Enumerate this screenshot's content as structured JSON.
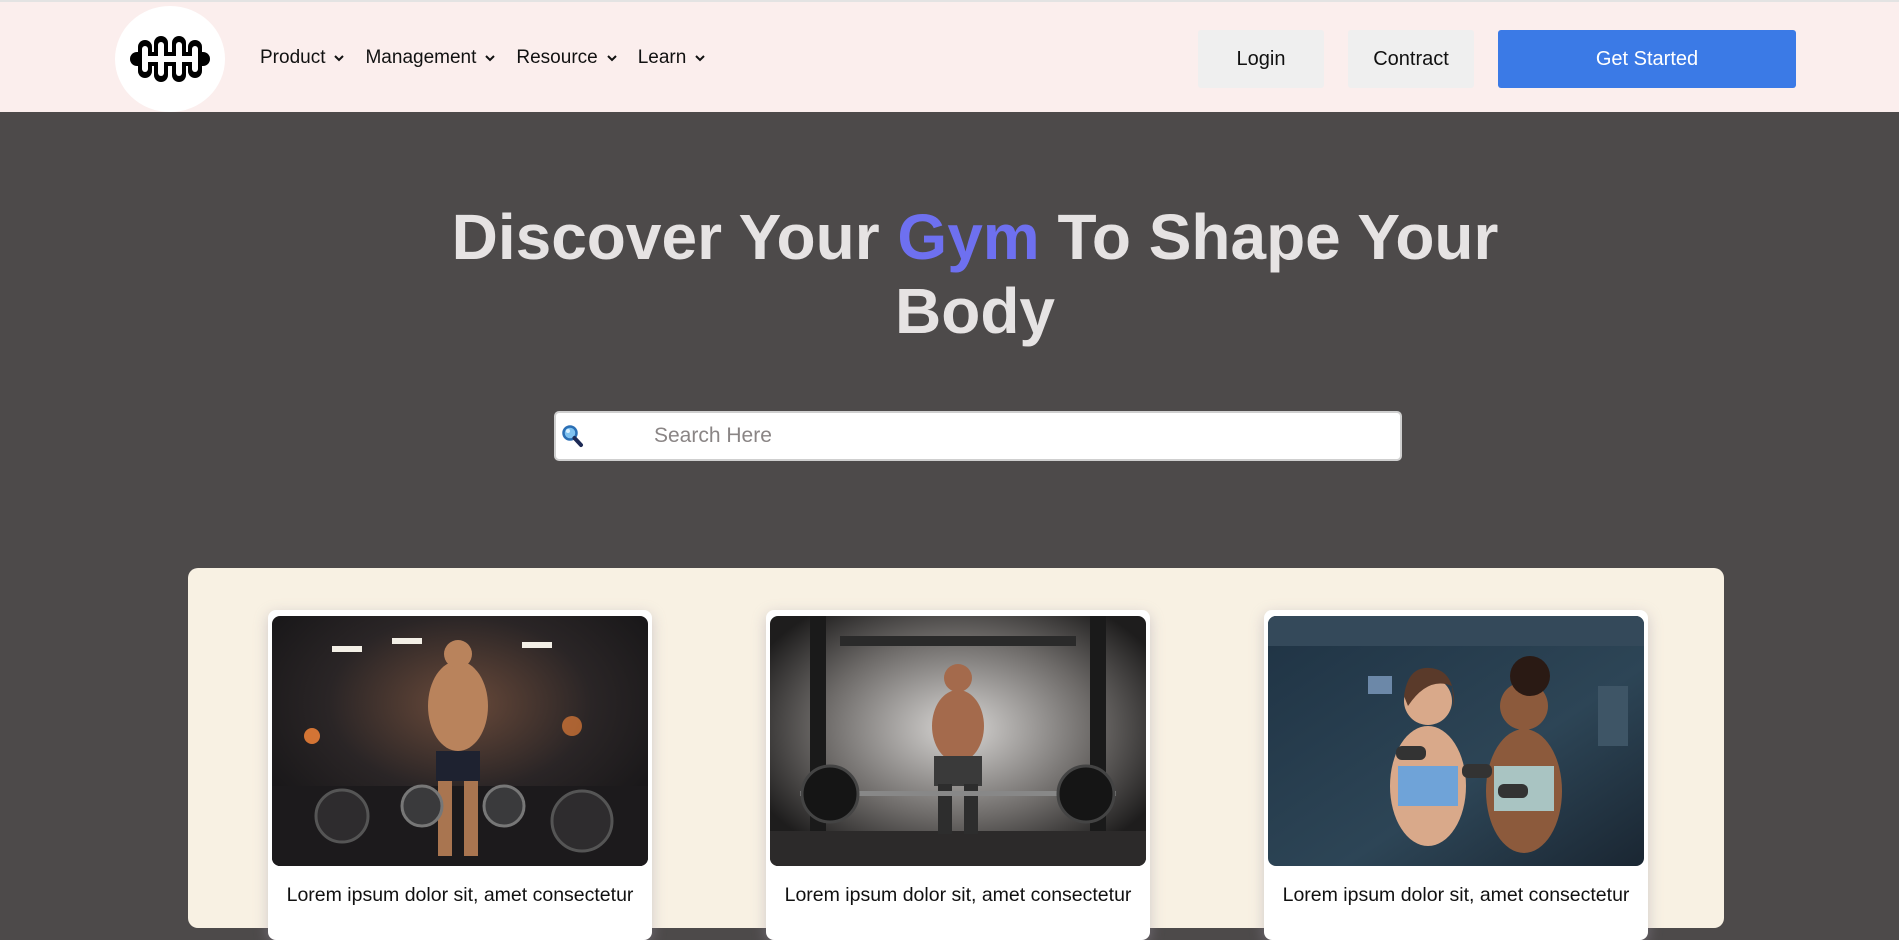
{
  "nav": {
    "logo_icon": "dumbbell-icon",
    "items": [
      {
        "label": "Product",
        "icon": "chevron-down-icon"
      },
      {
        "label": "Management",
        "icon": "chevron-down-icon"
      },
      {
        "label": "Resource",
        "icon": "chevron-down-icon"
      },
      {
        "label": "Learn",
        "icon": "chevron-down-icon"
      }
    ],
    "login_label": "Login",
    "contract_label": "Contract",
    "get_started_label": "Get Started"
  },
  "hero": {
    "title_part1": "Discover Your ",
    "title_accent": "Gym",
    "title_part2": " To Shape Your Body"
  },
  "search": {
    "icon": "magnifier-icon",
    "placeholder": "Search Here"
  },
  "cards": [
    {
      "image": "bodybuilder-carrying-weight-plates-photo",
      "caption": "Lorem ipsum dolor sit, amet consectetur"
    },
    {
      "image": "man-deadlifting-barbell-photo",
      "caption": "Lorem ipsum dolor sit, amet consectetur"
    },
    {
      "image": "two-women-with-dumbbells-photo",
      "caption": "Lorem ipsum dolor sit, amet consectetur"
    }
  ],
  "colors": {
    "header_bg": "#fbeeed",
    "page_bg": "#4d4a4a",
    "accent": "#6e70f0",
    "primary_button": "#3b7ae6",
    "cards_panel_bg": "#f8f1e3"
  }
}
